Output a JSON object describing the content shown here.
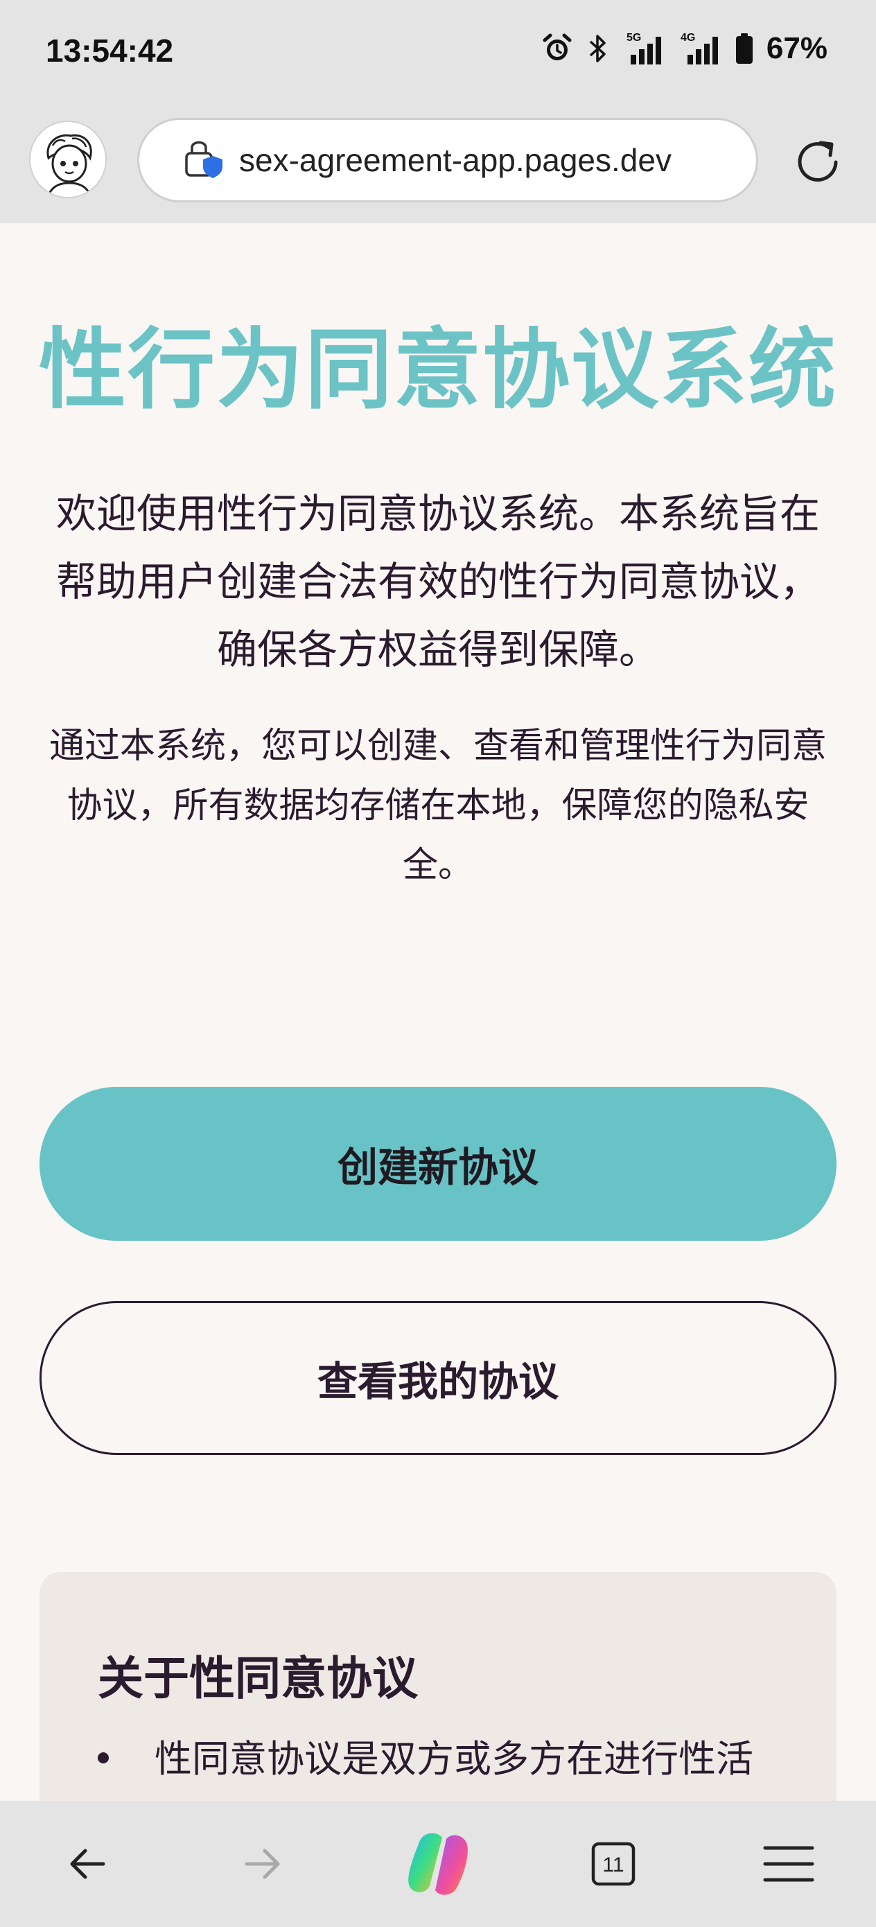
{
  "status_bar": {
    "time": "13:54:42",
    "network_5g": "5G",
    "network_4g": "4G",
    "battery": "67%"
  },
  "browser": {
    "url": "sex-agreement-app.pages.dev",
    "tab_count": "11"
  },
  "page": {
    "title": "性行为同意协议系统",
    "intro": "欢迎使用性行为同意协议系统。本系统旨在帮助用户创建合法有效的性行为同意协议，确保各方权益得到保障。",
    "intro2": "通过本系统，您可以创建、查看和管理性行为同意协议，所有数据均存储在本地，保障您的隐私安全。",
    "create_button": "创建新协议",
    "view_button": "查看我的协议",
    "about": {
      "title": "关于性同意协议",
      "items": [
        "性同意协议是双方或多方在进行性活"
      ]
    }
  },
  "colors": {
    "accent": "#68c3c6",
    "text": "#2b1b2f",
    "page_bg": "#faf6f3",
    "card_bg": "#efe9e6",
    "chrome_bg": "#e4e4e4"
  }
}
